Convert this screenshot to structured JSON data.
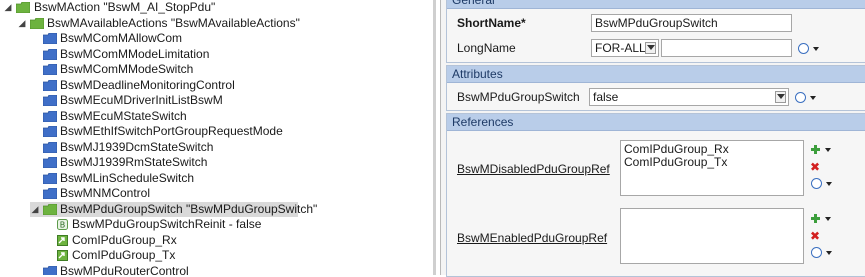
{
  "tree": {
    "items": [
      {
        "label": "BswMAction \"BswM_AI_StopPdu\"",
        "indent": 0,
        "expanded": true,
        "icon": "folder-green-icon"
      },
      {
        "label": "BswMAvailableActions \"BswMAvailableActions\"",
        "indent": 1,
        "expanded": true,
        "icon": "folder-green-icon"
      },
      {
        "label": "BswMComMAllowCom",
        "indent": 2,
        "icon": "folder-blue-icon"
      },
      {
        "label": "BswMComMModeLimitation",
        "indent": 2,
        "icon": "folder-blue-icon"
      },
      {
        "label": "BswMComMModeSwitch",
        "indent": 2,
        "icon": "folder-blue-icon"
      },
      {
        "label": "BswMDeadlineMonitoringControl",
        "indent": 2,
        "icon": "folder-blue-icon"
      },
      {
        "label": "BswMEcuMDriverInitListBswM",
        "indent": 2,
        "icon": "folder-blue-icon"
      },
      {
        "label": "BswMEcuMStateSwitch",
        "indent": 2,
        "icon": "folder-blue-icon"
      },
      {
        "label": "BswMEthIfSwitchPortGroupRequestMode",
        "indent": 2,
        "icon": "folder-blue-icon"
      },
      {
        "label": "BswMJ1939DcmStateSwitch",
        "indent": 2,
        "icon": "folder-blue-icon"
      },
      {
        "label": "BswMJ1939RmStateSwitch",
        "indent": 2,
        "icon": "folder-blue-icon"
      },
      {
        "label": "BswMLinScheduleSwitch",
        "indent": 2,
        "icon": "folder-blue-icon"
      },
      {
        "label": "BswMNMControl",
        "indent": 2,
        "icon": "folder-blue-icon"
      },
      {
        "label": "BswMPduGroupSwitch \"BswMPduGroupSwitch\"",
        "indent": 2,
        "expanded": true,
        "selected": true,
        "icon": "folder-green-icon"
      },
      {
        "label": "BswMPduGroupSwitchReinit - false",
        "indent": 3,
        "icon": "parameter-icon"
      },
      {
        "label": "ComIPduGroup_Rx",
        "indent": 3,
        "icon": "reference-icon"
      },
      {
        "label": "ComIPduGroup_Tx",
        "indent": 3,
        "icon": "reference-icon"
      },
      {
        "label": "BswMPduRouterControl",
        "indent": 2,
        "icon": "folder-blue-icon"
      }
    ]
  },
  "general": {
    "header": "General",
    "shortname_label": "ShortName*",
    "shortname_value": "BswMPduGroupSwitch",
    "longname_label": "LongName",
    "longname_lang": "FOR-ALL",
    "longname_value": ""
  },
  "attributes": {
    "header": "Attributes",
    "field_label": "BswMPduGroupSwitch",
    "field_value": "false"
  },
  "references": {
    "header": "References",
    "disabled_label": "BswMDisabledPduGroupRef",
    "disabled_items": [
      "ComIPduGroup_Rx",
      "ComIPduGroup_Tx"
    ],
    "enabled_label": "BswMEnabledPduGroupRef",
    "enabled_items": []
  },
  "colors": {
    "section_header": "#b9cde9",
    "folder_green": "#6db33f",
    "folder_blue": "#3f6fc8",
    "selection": "#d9d9d9"
  }
}
